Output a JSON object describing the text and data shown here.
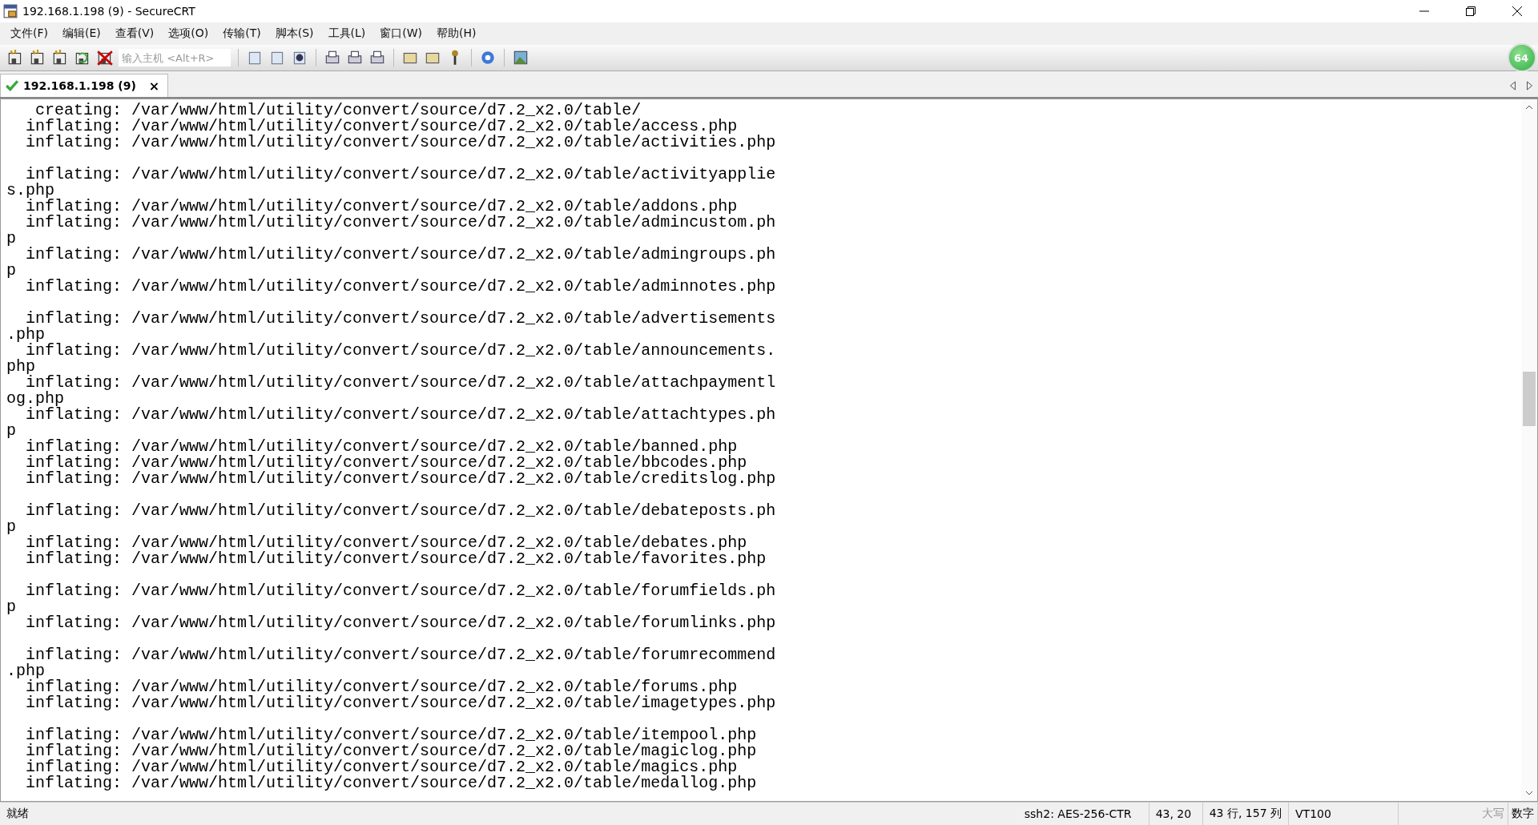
{
  "window": {
    "title": "192.168.1.198 (9) - SecureCRT"
  },
  "menu": [
    "文件(F)",
    "编辑(E)",
    "查看(V)",
    "选项(O)",
    "传输(T)",
    "脚本(S)",
    "工具(L)",
    "窗口(W)",
    "帮助(H)"
  ],
  "toolbar": {
    "host_field": {
      "placeholder": "输入主机 <Alt+R>"
    },
    "badge": "64"
  },
  "tabs": [
    {
      "label": "192.168.1.198 (9)",
      "selected": true,
      "connected": true,
      "close": "×"
    }
  ],
  "terminal": {
    "lines": [
      {
        "kind": "text",
        "text": "   creating: /var/www/html/utility/convert/source/d7.2_x2.0/table/"
      },
      {
        "kind": "text",
        "text": "  inflating: /var/www/html/utility/convert/source/d7.2_x2.0/table/access.php"
      },
      {
        "kind": "text",
        "text": "  inflating: /var/www/html/utility/convert/source/d7.2_x2.0/table/activities.php"
      },
      {
        "kind": "blank"
      },
      {
        "kind": "text",
        "text": "  inflating: /var/www/html/utility/convert/source/d7.2_x2.0/table/activityapplie"
      },
      {
        "kind": "text",
        "text": "s.php"
      },
      {
        "kind": "text",
        "text": "  inflating: /var/www/html/utility/convert/source/d7.2_x2.0/table/addons.php"
      },
      {
        "kind": "text",
        "text": "  inflating: /var/www/html/utility/convert/source/d7.2_x2.0/table/admincustom.ph"
      },
      {
        "kind": "text",
        "text": "p"
      },
      {
        "kind": "text",
        "text": "  inflating: /var/www/html/utility/convert/source/d7.2_x2.0/table/admingroups.ph"
      },
      {
        "kind": "text",
        "text": "p"
      },
      {
        "kind": "text",
        "text": "  inflating: /var/www/html/utility/convert/source/d7.2_x2.0/table/adminnotes.php"
      },
      {
        "kind": "blank"
      },
      {
        "kind": "text",
        "text": "  inflating: /var/www/html/utility/convert/source/d7.2_x2.0/table/advertisements"
      },
      {
        "kind": "text",
        "text": ".php"
      },
      {
        "kind": "text",
        "text": "  inflating: /var/www/html/utility/convert/source/d7.2_x2.0/table/announcements."
      },
      {
        "kind": "text",
        "text": "php"
      },
      {
        "kind": "text",
        "text": "  inflating: /var/www/html/utility/convert/source/d7.2_x2.0/table/attachpaymentl"
      },
      {
        "kind": "text",
        "text": "og.php"
      },
      {
        "kind": "text",
        "text": "  inflating: /var/www/html/utility/convert/source/d7.2_x2.0/table/attachtypes.ph"
      },
      {
        "kind": "text",
        "text": "p"
      },
      {
        "kind": "text",
        "text": "  inflating: /var/www/html/utility/convert/source/d7.2_x2.0/table/banned.php"
      },
      {
        "kind": "text",
        "text": "  inflating: /var/www/html/utility/convert/source/d7.2_x2.0/table/bbcodes.php"
      },
      {
        "kind": "text",
        "text": "  inflating: /var/www/html/utility/convert/source/d7.2_x2.0/table/creditslog.php"
      },
      {
        "kind": "blank"
      },
      {
        "kind": "text",
        "text": "  inflating: /var/www/html/utility/convert/source/d7.2_x2.0/table/debateposts.ph"
      },
      {
        "kind": "text",
        "text": "p"
      },
      {
        "kind": "text",
        "text": "  inflating: /var/www/html/utility/convert/source/d7.2_x2.0/table/debates.php"
      },
      {
        "kind": "text",
        "text": "  inflating: /var/www/html/utility/convert/source/d7.2_x2.0/table/favorites.php"
      },
      {
        "kind": "blank"
      },
      {
        "kind": "text",
        "text": "  inflating: /var/www/html/utility/convert/source/d7.2_x2.0/table/forumfields.ph"
      },
      {
        "kind": "text",
        "text": "p"
      },
      {
        "kind": "text",
        "text": "  inflating: /var/www/html/utility/convert/source/d7.2_x2.0/table/forumlinks.php"
      },
      {
        "kind": "blank"
      },
      {
        "kind": "text",
        "text": "  inflating: /var/www/html/utility/convert/source/d7.2_x2.0/table/forumrecommend"
      },
      {
        "kind": "text",
        "text": ".php"
      },
      {
        "kind": "text",
        "text": "  inflating: /var/www/html/utility/convert/source/d7.2_x2.0/table/forums.php"
      },
      {
        "kind": "text",
        "text": "  inflating: /var/www/html/utility/convert/source/d7.2_x2.0/table/imagetypes.php"
      },
      {
        "kind": "blank"
      },
      {
        "kind": "text",
        "text": "  inflating: /var/www/html/utility/convert/source/d7.2_x2.0/table/itempool.php"
      },
      {
        "kind": "text",
        "text": "  inflating: /var/www/html/utility/convert/source/d7.2_x2.0/table/magiclog.php"
      },
      {
        "kind": "text",
        "text": "  inflating: /var/www/html/utility/convert/source/d7.2_x2.0/table/magics.php"
      },
      {
        "kind": "text",
        "text": "  inflating: /var/www/html/utility/convert/source/d7.2_x2.0/table/medallog.php"
      }
    ]
  },
  "status_bar": {
    "status": "就绪",
    "cipher": "ssh2: AES-256-CTR",
    "cursor": "43,  20",
    "size": "43 行, 157 列",
    "terminal_type": "VT100",
    "indicators": [
      {
        "label": "大写",
        "on": false
      },
      {
        "label": "数字",
        "on": true
      }
    ]
  }
}
